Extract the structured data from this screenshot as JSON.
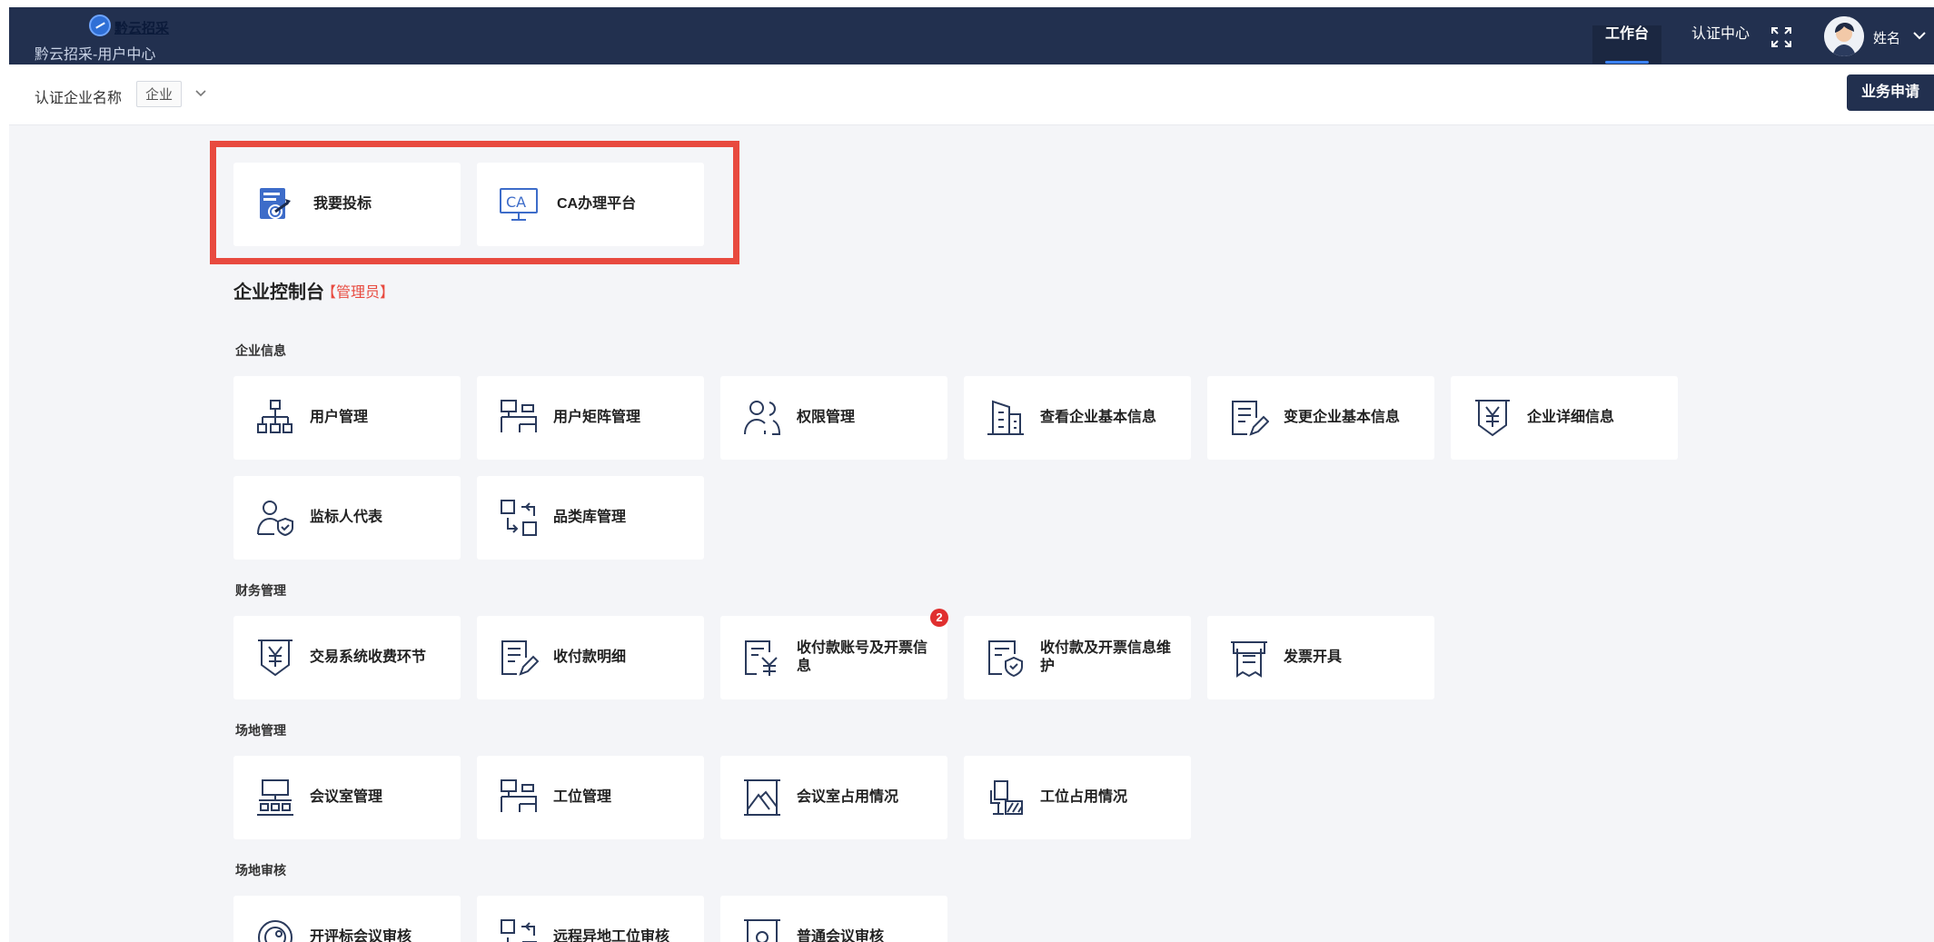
{
  "header": {
    "logo_word": "黔云招采",
    "logo_sub": "黔云招采-用户中心",
    "nav": [
      {
        "label": "工作台",
        "active": true
      },
      {
        "label": "认证中心",
        "active": false
      }
    ],
    "user_name": "姓名",
    "icons": {
      "fullscreen": "fullscreen-icon",
      "avatar": "avatar",
      "caret": "chevron-down-icon"
    }
  },
  "subbar": {
    "label": "认证企业名称",
    "tag": "企业",
    "business_button": "业务申请"
  },
  "quick": [
    {
      "label": "我要投标",
      "icon": "bid-document-icon"
    },
    {
      "label": "CA办理平台",
      "icon": "ca-monitor-icon",
      "icon_text": "CA"
    }
  ],
  "console": {
    "title": "企业控制台",
    "role": "【管理员】"
  },
  "sections": {
    "company": {
      "title": "企业信息",
      "items": [
        {
          "label": "用户管理",
          "icon": "org-chart-icon"
        },
        {
          "label": "用户矩阵管理",
          "icon": "workstation-icon"
        },
        {
          "label": "权限管理",
          "icon": "users-icon"
        },
        {
          "label": "查看企业基本信息",
          "icon": "building-icon"
        },
        {
          "label": "变更企业基本信息",
          "icon": "edit-document-icon"
        },
        {
          "label": "企业详细信息",
          "icon": "yen-shield-icon"
        },
        {
          "label": "监标人代表",
          "icon": "user-shield-icon"
        },
        {
          "label": "品类库管理",
          "icon": "category-swap-icon"
        }
      ]
    },
    "finance": {
      "title": "财务管理",
      "items": [
        {
          "label": "交易系统收费环节",
          "icon": "yen-shield-icon"
        },
        {
          "label": "收付款明细",
          "icon": "edit-document-icon"
        },
        {
          "label": "收付款账号及开票信息",
          "icon": "yen-document-icon",
          "badge": "2"
        },
        {
          "label": "收付款及开票信息维护",
          "icon": "shield-document-icon"
        },
        {
          "label": "发票开具",
          "icon": "invoice-printer-icon"
        }
      ]
    },
    "venue": {
      "title": "场地管理",
      "items": [
        {
          "label": "会议室管理",
          "icon": "meeting-room-icon"
        },
        {
          "label": "工位管理",
          "icon": "workstation-icon"
        },
        {
          "label": "会议室占用情况",
          "icon": "room-usage-icon"
        },
        {
          "label": "工位占用情况",
          "icon": "seat-usage-icon"
        }
      ]
    },
    "review": {
      "title": "场地审核",
      "items": [
        {
          "label": "开评标会议审核",
          "icon": "meeting-review-icon"
        },
        {
          "label": "远程异地工位审核",
          "icon": "remote-seat-icon"
        },
        {
          "label": "普通会议审核",
          "icon": "general-meeting-icon"
        }
      ]
    }
  }
}
